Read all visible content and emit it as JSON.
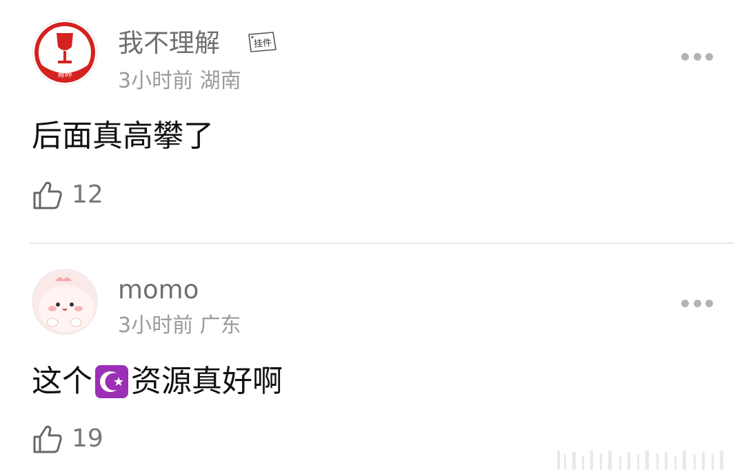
{
  "comments": [
    {
      "username": "我不理解",
      "badge_label": "挂件",
      "avatar_icon": "fragile-glass-icon",
      "avatar_text": "易碎",
      "time": "3小时前",
      "location": "湖南",
      "text": "后面真高攀了",
      "likes": "12"
    },
    {
      "username": "momo",
      "avatar_icon": "cute-pink-character-avatar",
      "time": "3小时前",
      "location": "广东",
      "text_before": "这个",
      "emoji": "star-and-crescent-emoji",
      "text_after": "资源真好啊",
      "likes": "19"
    }
  ],
  "colors": {
    "username": "#6f6f6f",
    "meta": "#9a9a9a",
    "body_text": "#111111",
    "accent_red": "#d42220",
    "emoji_purple": "#9b2fb5"
  }
}
